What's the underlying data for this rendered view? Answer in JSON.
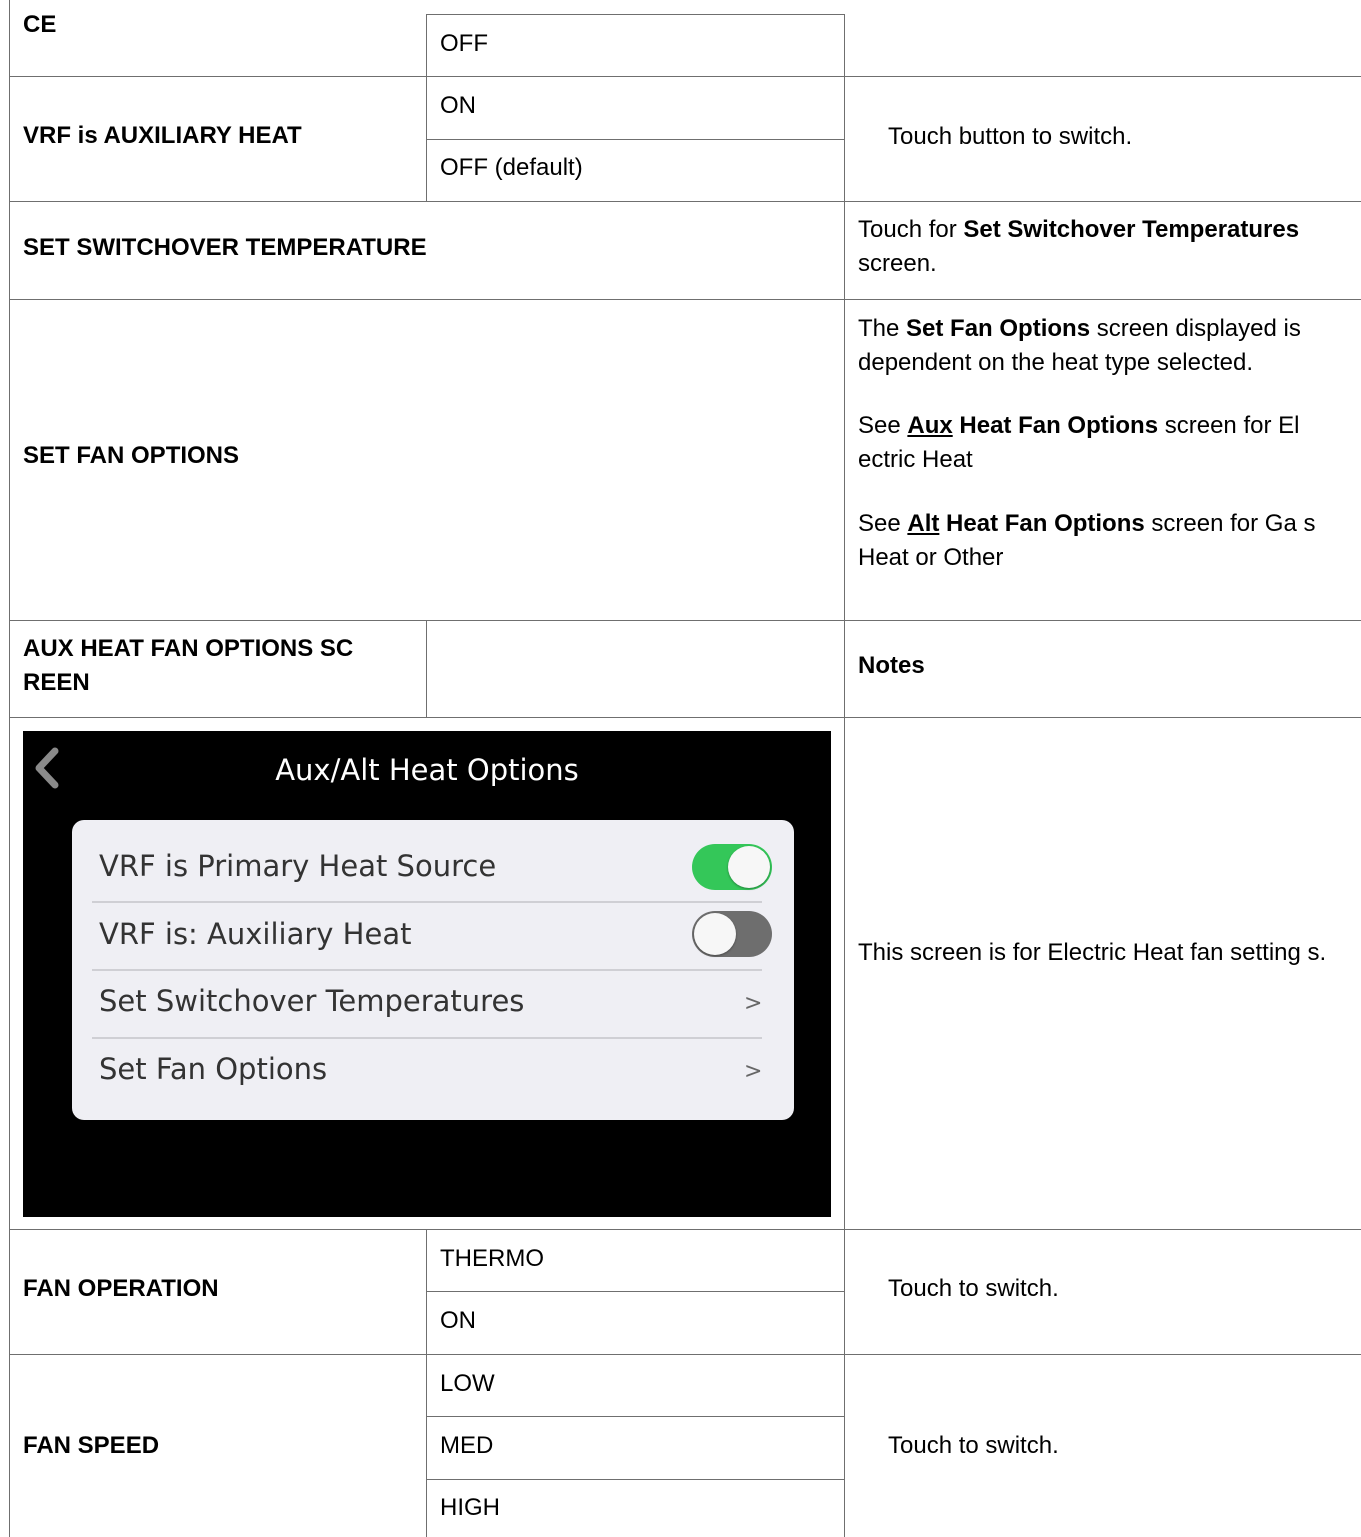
{
  "rows": {
    "ce": {
      "label": "CE",
      "option": "OFF"
    },
    "vrf_aux": {
      "label": "VRF is AUXILIARY HEAT",
      "options": [
        "ON",
        "OFF (default)"
      ],
      "note": "Touch button to switch."
    },
    "switchover": {
      "label": "SET SWITCHOVER TEMPERATURE",
      "note_prefix": "Touch for ",
      "note_bold": "Set Switchover Temperatures",
      "note_suffix": " screen."
    },
    "fan_options": {
      "label": "SET FAN OPTIONS",
      "p1_a": "The ",
      "p1_bold": "Set Fan Options",
      "p1_b": " screen displayed is dependent on the heat type selected.",
      "p2_a": "See ",
      "p2_link": "Aux",
      "p2_bold": " Heat Fan Options",
      "p2_b": " screen for El ectric Heat",
      "p3_a": "See ",
      "p3_link": "Alt",
      "p3_bold": " Heat Fan Options",
      "p3_b": " screen for Ga s Heat or Other"
    },
    "aux_header": {
      "label": "AUX HEAT FAN OPTIONS SC REEN",
      "notes": "Notes"
    },
    "screenshot": {
      "title": "Aux/Alt Heat Options",
      "items": [
        {
          "label": "VRF is Primary Heat Source",
          "toggle": true
        },
        {
          "label": "VRF is: Auxiliary Heat",
          "toggle": false
        },
        {
          "label": "Set Switchover Temperatures",
          "chevron": ">"
        },
        {
          "label": "Set Fan Options",
          "chevron": ">"
        }
      ],
      "note": "This screen is for Electric Heat fan setting s.",
      "toggle_on_color": "#34c759",
      "toggle_off_color": "#6e6e6e"
    },
    "fan_operation": {
      "label": "FAN OPERATION",
      "options": [
        "THERMO",
        "ON"
      ],
      "note": "Touch to switch."
    },
    "fan_speed": {
      "label": "FAN SPEED",
      "options": [
        "LOW",
        "MED",
        "HIGH"
      ],
      "note": "Touch to switch."
    }
  }
}
